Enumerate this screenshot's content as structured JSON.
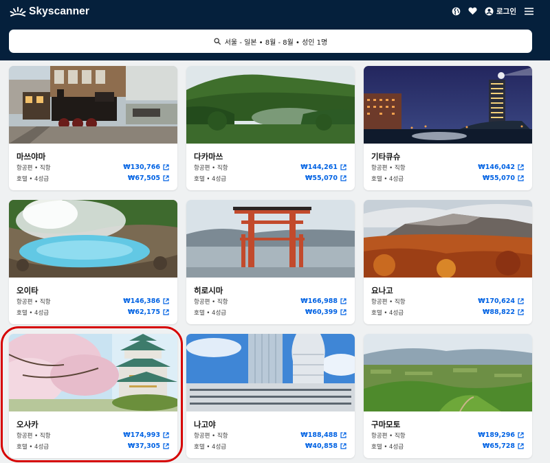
{
  "header": {
    "brand_name": "Skyscanner",
    "login_label": "로그인",
    "icons": [
      "sunburst-logo-icon",
      "globe-icon",
      "heart-icon",
      "account-icon",
      "menu-icon"
    ],
    "background": "#05203c"
  },
  "search": {
    "summary": "서울 - 일본  •  8월 - 8월  •  성인 1명"
  },
  "theme": {
    "price_color": "#0062e3",
    "highlight_color": "#d60000"
  },
  "destinations": [
    {
      "name": "마쓰야마",
      "flight_label": "항공편 • 직항",
      "flight_price": "₩130,766",
      "hotel_label": "호텔 • 4성급",
      "hotel_price": "₩67,505",
      "image": "steam-train-station"
    },
    {
      "name": "다카마쓰",
      "flight_label": "항공편 • 직항",
      "flight_price": "₩144,261",
      "hotel_label": "호텔 • 4성급",
      "hotel_price": "₩55,070",
      "image": "garden-pond"
    },
    {
      "name": "기타큐슈",
      "flight_label": "항공편 • 직항",
      "flight_price": "₩146,042",
      "hotel_label": "호텔 • 4성급",
      "hotel_price": "₩55,070",
      "image": "night-city"
    },
    {
      "name": "오이타",
      "flight_label": "항공편 • 직항",
      "flight_price": "₩146,386",
      "hotel_label": "호텔 • 4성급",
      "hotel_price": "₩62,175",
      "image": "blue-hot-spring"
    },
    {
      "name": "히로시마",
      "flight_label": "항공편 • 직항",
      "flight_price": "₩166,988",
      "hotel_label": "호텔 • 4성급",
      "hotel_price": "₩60,399",
      "image": "floating-torii"
    },
    {
      "name": "요나고",
      "flight_label": "항공편 • 직항",
      "flight_price": "₩170,624",
      "hotel_label": "호텔 • 4성급",
      "hotel_price": "₩88,822",
      "image": "autumn-mountain"
    },
    {
      "name": "오사카",
      "flight_label": "항공편 • 직항",
      "flight_price": "₩174,993",
      "hotel_label": "호텔 • 4성급",
      "hotel_price": "₩37,305",
      "image": "castle-cherry-blossom",
      "highlighted": true
    },
    {
      "name": "나고야",
      "flight_label": "항공편 • 직항",
      "flight_price": "₩188,488",
      "hotel_label": "호텔 • 4성급",
      "hotel_price": "₩40,858",
      "image": "skyscrapers"
    },
    {
      "name": "구마모토",
      "flight_label": "항공편 • 직항",
      "flight_price": "₩189,296",
      "hotel_label": "호텔 • 4성급",
      "hotel_price": "₩65,728",
      "image": "green-caldera"
    }
  ]
}
